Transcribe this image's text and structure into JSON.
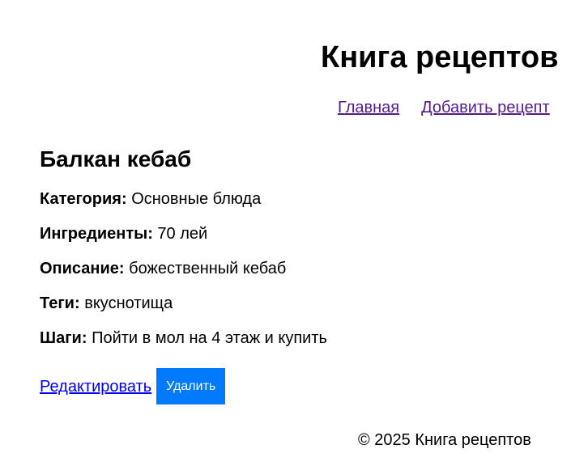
{
  "header": {
    "title": "Книга рецептов",
    "nav": {
      "home_label": "Главная",
      "add_recipe_label": "Добавить рецепт"
    }
  },
  "recipe": {
    "title": "Балкан кебаб",
    "fields": [
      {
        "label": "Категория:",
        "value": "Основные блюда"
      },
      {
        "label": "Ингредиенты:",
        "value": "70 лей"
      },
      {
        "label": "Описание:",
        "value": "божественный кебаб"
      },
      {
        "label": "Теги:",
        "value": "вкуснотища"
      },
      {
        "label": "Шаги:",
        "value": "Пойти в мол на 4 этаж и купить"
      }
    ],
    "actions": {
      "edit_label": "Редактировать",
      "delete_label": "Удалить"
    }
  },
  "footer": {
    "text": "© 2025 Книга рецептов"
  },
  "colors": {
    "visited_link": "#551a8b",
    "link": "#0000ee",
    "delete_button_bg": "#007bff",
    "delete_button_text": "#ffffff"
  }
}
